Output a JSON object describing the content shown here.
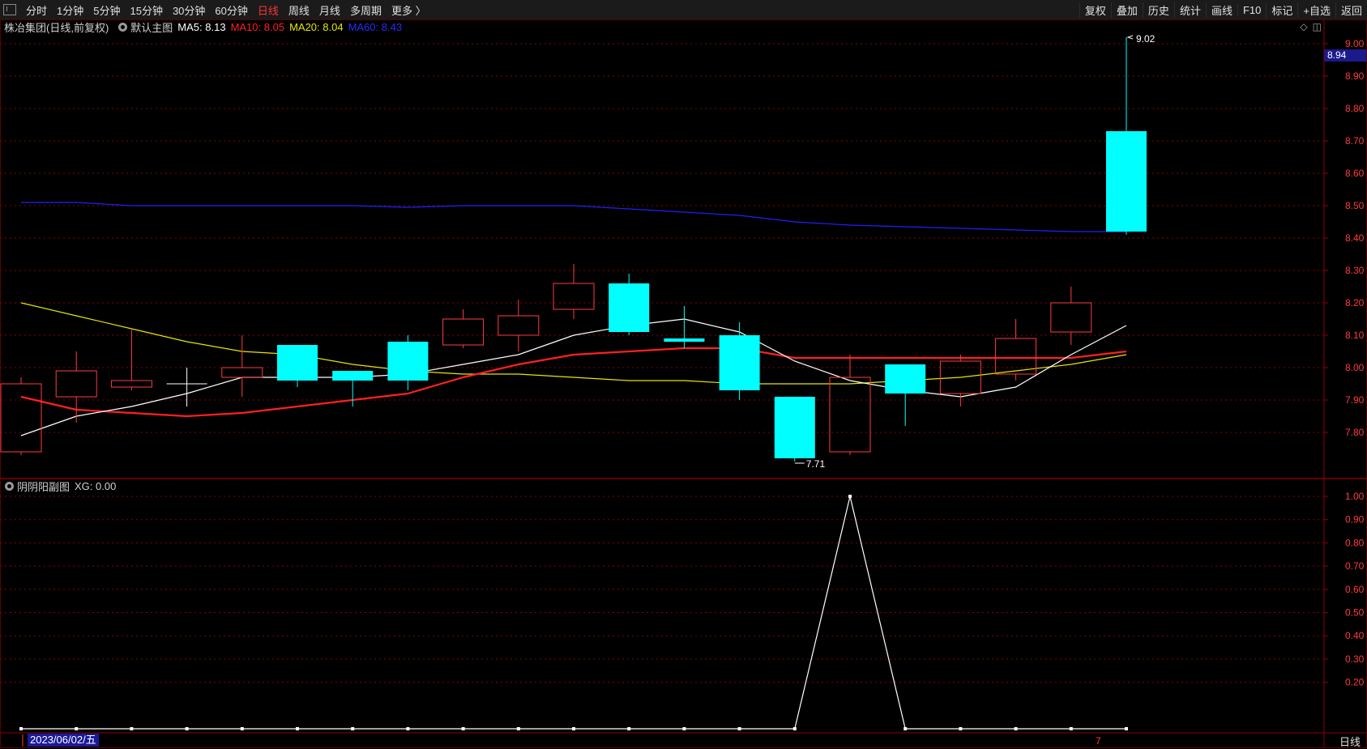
{
  "toolbar": {
    "periods": [
      "分时",
      "1分钟",
      "5分钟",
      "15分钟",
      "30分钟",
      "60分钟",
      "日线",
      "周线",
      "月线",
      "多周期",
      "更多 〉"
    ],
    "active_period": "日线",
    "right_items": [
      "复权",
      "叠加",
      "历史",
      "统计",
      "画线",
      "F10",
      "标记",
      "+自选",
      "返回"
    ]
  },
  "main_header": {
    "stock": "株冶集团(日线,前复权)",
    "chart_name": "默认主图",
    "ma5": "MA5: 8.13",
    "ma10": "MA10: 8.05",
    "ma20": "MA20: 8.04",
    "ma60": "MA60: 8.43"
  },
  "sub_header": {
    "name": "阴阴阳副图",
    "xg": "XG: 0.00"
  },
  "footer": {
    "date": "2023/06/02/五",
    "period": "日线",
    "marker": "7"
  },
  "current_price_tag": "8.94",
  "high_label": "9.02",
  "low_label": "7.71",
  "colors": {
    "up": "#ff3b3b",
    "down": "#00ffff",
    "ma5": "#ffffff",
    "ma10": "#ff2020",
    "ma20": "#e6e600",
    "ma60": "#2020ff",
    "grid": "#8b0000"
  },
  "chart_data": [
    {
      "type": "candlestick",
      "title": "株冶集团(日线,前复权)",
      "y_ticks": [
        "9.00",
        "8.90",
        "8.80",
        "8.70",
        "8.60",
        "8.50",
        "8.40",
        "8.30",
        "8.20",
        "8.10",
        "8.00",
        "7.90",
        "7.80"
      ],
      "ylim": [
        7.62,
        9.06
      ],
      "candles": [
        {
          "o": 7.74,
          "h": 7.97,
          "l": 7.73,
          "c": 7.95
        },
        {
          "o": 7.91,
          "h": 8.05,
          "l": 7.83,
          "c": 7.99
        },
        {
          "o": 7.94,
          "h": 8.12,
          "l": 7.93,
          "c": 7.96
        },
        {
          "o": 7.95,
          "h": 8.0,
          "l": 7.88,
          "c": 7.95
        },
        {
          "o": 7.97,
          "h": 8.1,
          "l": 7.91,
          "c": 8.0
        },
        {
          "o": 8.07,
          "h": 8.07,
          "l": 7.94,
          "c": 7.96
        },
        {
          "o": 7.99,
          "h": 7.99,
          "l": 7.88,
          "c": 7.96
        },
        {
          "o": 8.08,
          "h": 8.1,
          "l": 7.93,
          "c": 7.96
        },
        {
          "o": 8.07,
          "h": 8.18,
          "l": 8.06,
          "c": 8.15
        },
        {
          "o": 8.1,
          "h": 8.21,
          "l": 8.05,
          "c": 8.16
        },
        {
          "o": 8.18,
          "h": 8.32,
          "l": 8.15,
          "c": 8.26
        },
        {
          "o": 8.26,
          "h": 8.29,
          "l": 8.1,
          "c": 8.11
        },
        {
          "o": 8.09,
          "h": 8.19,
          "l": 8.06,
          "c": 8.08
        },
        {
          "o": 8.1,
          "h": 8.14,
          "l": 7.9,
          "c": 7.93
        },
        {
          "o": 7.91,
          "h": 7.91,
          "l": 7.71,
          "c": 7.72
        },
        {
          "o": 7.74,
          "h": 8.04,
          "l": 7.73,
          "c": 7.97
        },
        {
          "o": 8.01,
          "h": 8.01,
          "l": 7.82,
          "c": 7.92
        },
        {
          "o": 7.92,
          "h": 8.04,
          "l": 7.88,
          "c": 8.02
        },
        {
          "o": 7.98,
          "h": 8.15,
          "l": 7.96,
          "c": 8.09
        },
        {
          "o": 8.11,
          "h": 8.25,
          "l": 8.07,
          "c": 8.2
        },
        {
          "o": 8.73,
          "h": 9.02,
          "l": 8.41,
          "c": 8.42
        }
      ],
      "ma5": [
        7.79,
        7.85,
        7.88,
        7.92,
        7.97,
        7.97,
        7.97,
        7.98,
        8.01,
        8.04,
        8.1,
        8.13,
        8.15,
        8.11,
        8.02,
        7.96,
        7.93,
        7.91,
        7.94,
        8.04,
        8.13
      ],
      "ma10": [
        7.91,
        7.87,
        7.86,
        7.85,
        7.86,
        7.88,
        7.9,
        7.92,
        7.97,
        8.01,
        8.04,
        8.05,
        8.06,
        8.06,
        8.03,
        8.03,
        8.03,
        8.03,
        8.03,
        8.03,
        8.05
      ],
      "ma20": [
        8.2,
        8.16,
        8.12,
        8.08,
        8.05,
        8.04,
        8.01,
        7.99,
        7.98,
        7.98,
        7.97,
        7.96,
        7.96,
        7.95,
        7.95,
        7.95,
        7.96,
        7.97,
        7.99,
        8.01,
        8.04
      ],
      "ma60": [
        8.51,
        8.51,
        8.5,
        8.5,
        8.5,
        8.5,
        8.5,
        8.495,
        8.5,
        8.5,
        8.5,
        8.49,
        8.48,
        8.47,
        8.45,
        8.44,
        8.435,
        8.43,
        8.425,
        8.42,
        8.42
      ]
    },
    {
      "type": "line",
      "title": "阴阴阳副图",
      "y_ticks": [
        "1.00",
        "0.90",
        "0.80",
        "0.70",
        "0.60",
        "0.50",
        "0.40",
        "0.30",
        "0.20"
      ],
      "ylim": [
        0,
        1
      ],
      "series": [
        {
          "name": "XG",
          "values": [
            0,
            0,
            0,
            0,
            0,
            0,
            0,
            0,
            0,
            0,
            0,
            0,
            0,
            0,
            0,
            1,
            0,
            0,
            0,
            0,
            0
          ]
        }
      ]
    }
  ]
}
